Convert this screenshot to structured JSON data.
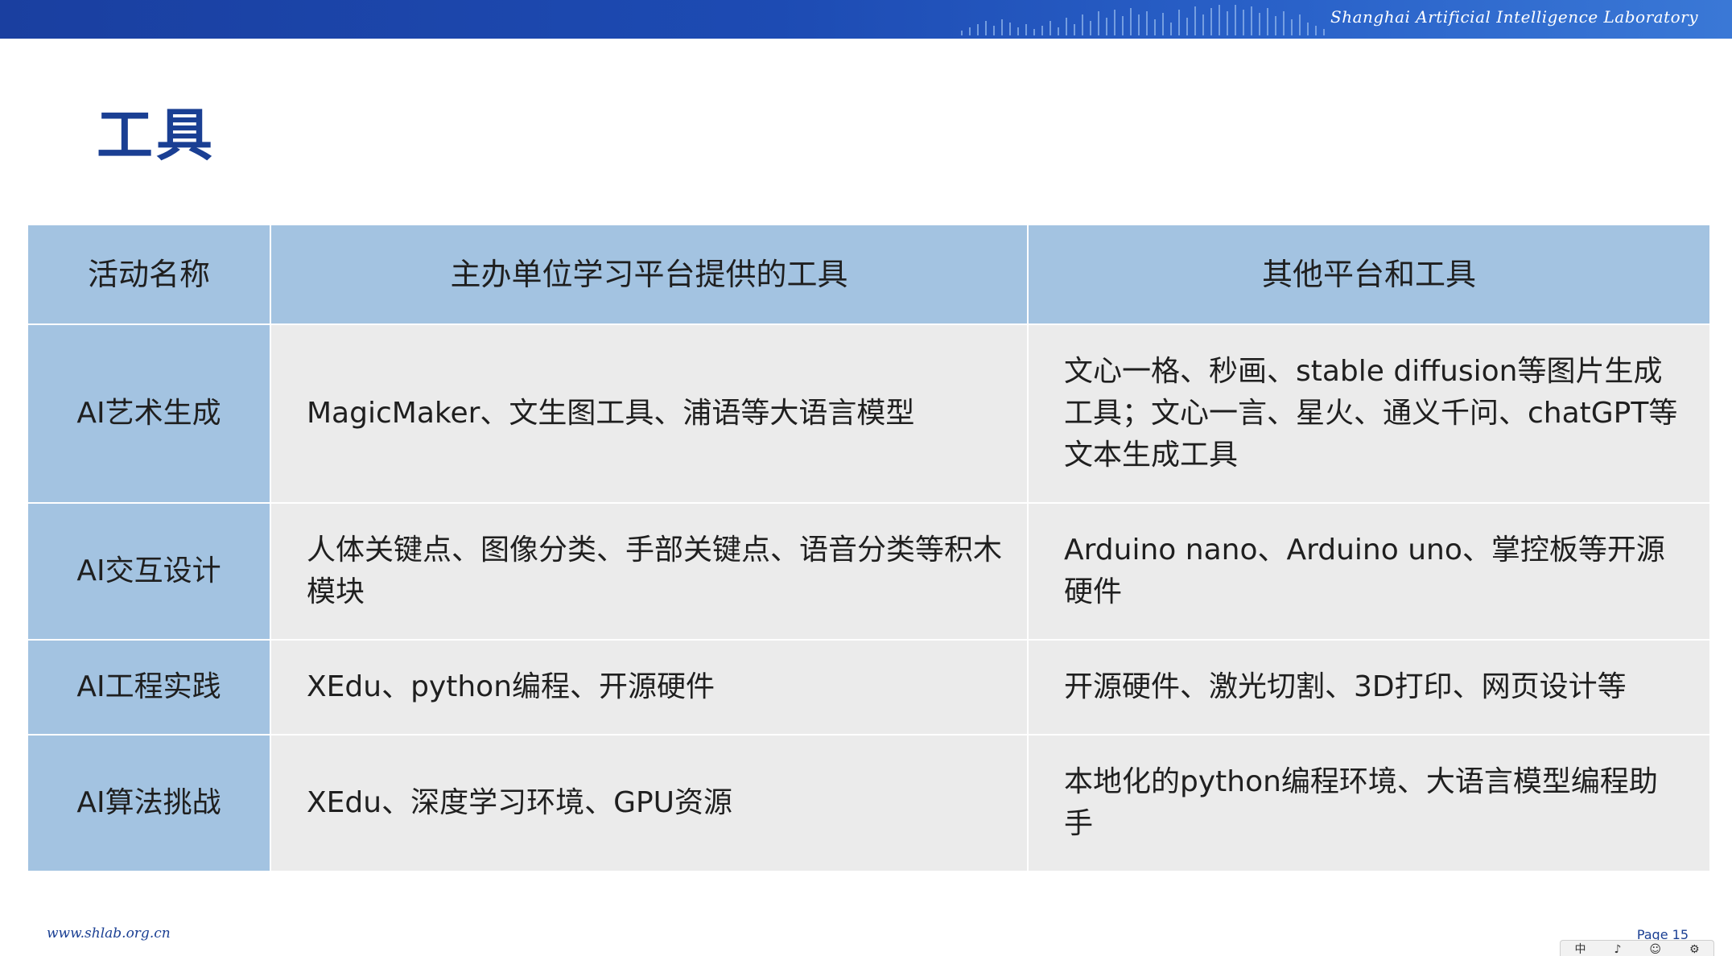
{
  "banner": {
    "org_name": "Shanghai Artificial Intelligence Laboratory",
    "accent_color": "#1d4bb3"
  },
  "page": {
    "title": "工具",
    "title_color": "#1a3f93"
  },
  "table": {
    "headers": [
      "活动名称",
      "主办单位学习平台提供的工具",
      "其他平台和工具"
    ],
    "header_bg": "#a3c3e1",
    "body_bg": "#ebebeb",
    "rows": [
      {
        "name": "AI艺术生成",
        "host_tools": "MagicMaker、文生图工具、浦语等大语言模型",
        "other_tools": "文心一格、秒画、stable diffusion等图片生成工具；文心一言、星火、通义千问、chatGPT等文本生成工具"
      },
      {
        "name": "AI交互设计",
        "host_tools": "人体关键点、图像分类、手部关键点、语音分类等积木模块",
        "other_tools": "Arduino nano、Arduino uno、掌控板等开源硬件"
      },
      {
        "name": "AI工程实践",
        "host_tools": "XEdu、python编程、开源硬件",
        "other_tools": "开源硬件、激光切割、3D打印、网页设计等"
      },
      {
        "name": "AI算法挑战",
        "host_tools": "XEdu、深度学习环境、GPU资源",
        "other_tools": "本地化的python编程环境、大语言模型编程助手"
      }
    ]
  },
  "footer": {
    "url": "www.shlab.org.cn",
    "page_label": "Page 15"
  },
  "ime_toolbar": {
    "items": [
      "中",
      "♪",
      "☺",
      "⚙"
    ],
    "icons": [
      "ime-mode-icon",
      "mic-icon",
      "emoji-icon",
      "settings-icon"
    ]
  }
}
